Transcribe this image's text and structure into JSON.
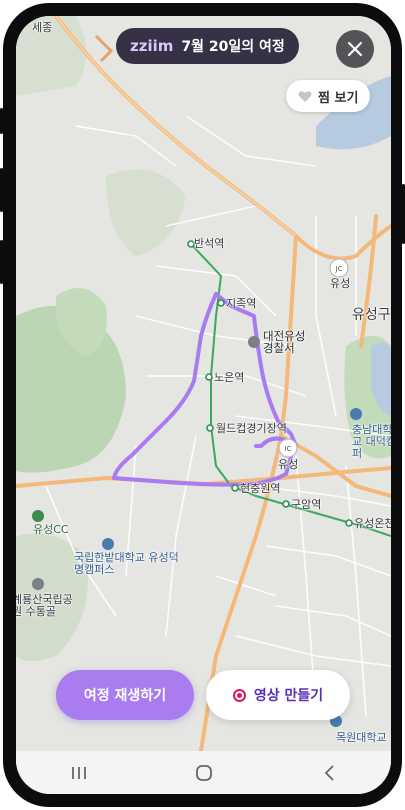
{
  "header": {
    "brand": "zziim",
    "trip_title": "7월 20일의 여정"
  },
  "favorite_button": {
    "label": "찜 보기",
    "icon": "heart-icon"
  },
  "close_button": {
    "icon": "close-icon"
  },
  "actions": {
    "replay_label": "여정 재생하기",
    "make_video_label": "영상 만들기",
    "make_video_icon": "record-icon"
  },
  "map": {
    "stations": [
      "반석역",
      "지족역",
      "노은역",
      "월드컵경기장역",
      "현충원역",
      "구암역",
      "유성온천"
    ],
    "places": [
      "대전유성 경찰서",
      "충남대학교 대덕캠퍼",
      "국립한밭대학교 유성덕명캠퍼스",
      "유성CC",
      "계룡산국립공원 수통골",
      "목원대학교"
    ],
    "area_labels": [
      "유성구",
      "세종"
    ],
    "interchanges": [
      "유성",
      "유성"
    ],
    "route_color": "#a77cf2",
    "subway_color": "#3aa860"
  },
  "navbar": {
    "items": [
      "recent-apps-icon",
      "home-icon",
      "back-icon"
    ]
  }
}
